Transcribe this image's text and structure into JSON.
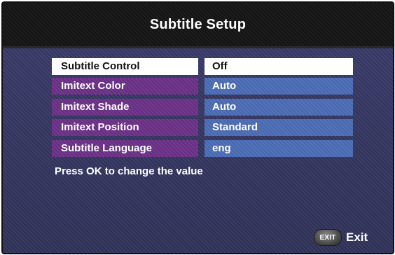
{
  "title": "Subtitle Setup",
  "settings": [
    {
      "label": "Subtitle Control",
      "value": "Off",
      "selected": true
    },
    {
      "label": "Imitext Color",
      "value": "Auto",
      "selected": false
    },
    {
      "label": "Imitext Shade",
      "value": "Auto",
      "selected": false
    },
    {
      "label": "Imitext Position",
      "value": "Standard",
      "selected": false
    },
    {
      "label": "Subtitle Language",
      "value": "eng",
      "selected": false
    }
  ],
  "hint": "Press OK to change the value",
  "exit": {
    "icon_text": "EXIT",
    "label": "Exit",
    "icon": "exit-key-icon"
  },
  "colors": {
    "background": "#3a3b6a",
    "title_bar": "#141414",
    "label_cell": "#6a2f86",
    "value_cell": "#4a6bb5",
    "selected_cell": "#ffffff"
  }
}
